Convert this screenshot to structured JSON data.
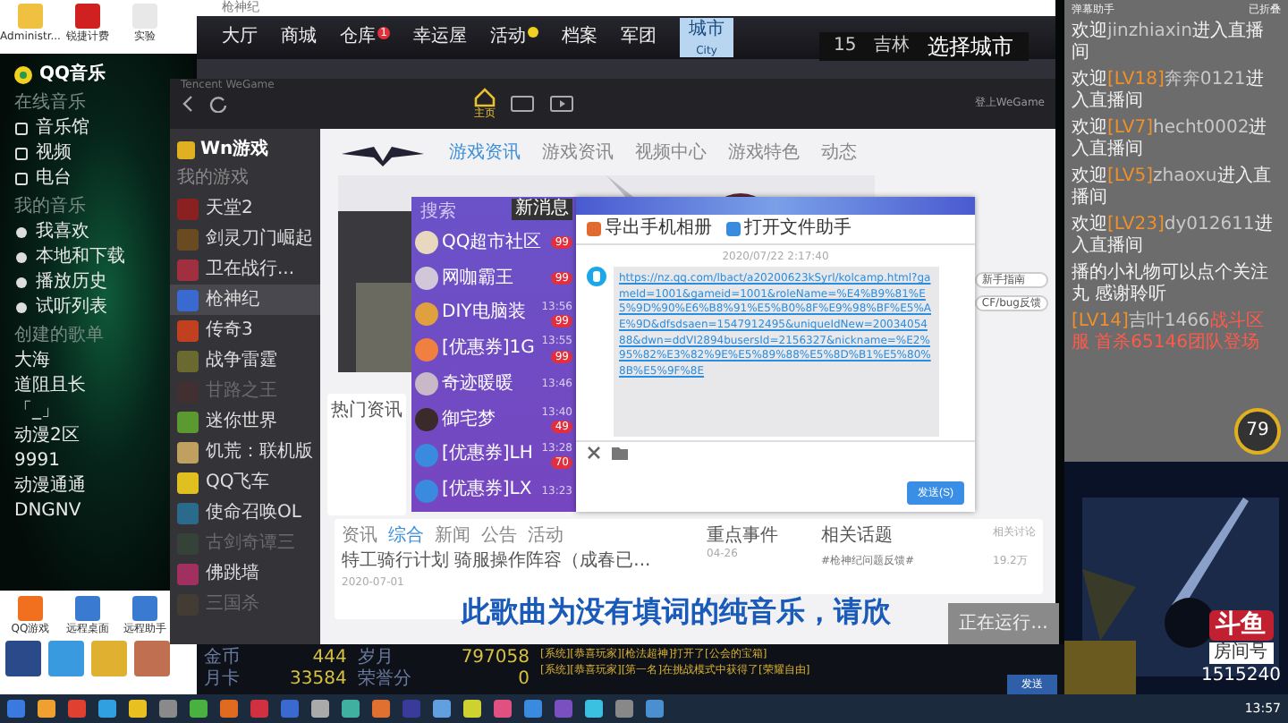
{
  "desktop_top_icons": [
    {
      "label": "Administr..."
    },
    {
      "label": "锐捷计费"
    },
    {
      "label": "实验"
    }
  ],
  "music_player": {
    "title": "QQ音乐",
    "group_label": "在线音乐",
    "items": [
      {
        "label": "音乐馆"
      },
      {
        "label": "视频"
      },
      {
        "label": "电台"
      }
    ],
    "my_label": "我的音乐",
    "my_items": [
      {
        "label": "我喜欢"
      },
      {
        "label": "本地和下载"
      },
      {
        "label": "播放历史"
      },
      {
        "label": "试听列表"
      }
    ],
    "playlists_label": "创建的歌单",
    "playlists": [
      {
        "label": "大海"
      },
      {
        "label": "道阻且长"
      },
      {
        "label": "「_」"
      },
      {
        "label": "动漫2区"
      },
      {
        "label": "9991"
      },
      {
        "label": "动漫通通"
      },
      {
        "label": "DNGNV"
      }
    ]
  },
  "desktop_bottom_icons": [
    {
      "label": "QQ游戏"
    },
    {
      "label": "远程桌面"
    },
    {
      "label": "远程助手"
    }
  ],
  "game_window": {
    "title": "枪神纪",
    "nav": [
      {
        "label": "大厅",
        "selected": false,
        "dot": false
      },
      {
        "label": "商城",
        "selected": false,
        "dot": false
      },
      {
        "label": "仓库",
        "selected": false,
        "dot": false,
        "badge": "1"
      },
      {
        "label": "幸运屋",
        "selected": false,
        "dot": false
      },
      {
        "label": "活动",
        "selected": false,
        "dot": true
      },
      {
        "label": "档案",
        "selected": false,
        "dot": false
      },
      {
        "label": "军团",
        "selected": false,
        "dot": false
      },
      {
        "label": "城市",
        "sublabel": "City",
        "selected": true,
        "dot": false
      }
    ],
    "channel": "15",
    "region": "吉林",
    "select_city": "选择城市"
  },
  "wegame": {
    "title": "Tencent WeGame",
    "home_label": "主页",
    "login": "登上WeGame",
    "account": "Wn游戏",
    "group": "我的游戏",
    "games": [
      {
        "name": "天堂2",
        "dimmed": false,
        "selected": false
      },
      {
        "name": "剑灵刀门崛起",
        "dimmed": false,
        "selected": false
      },
      {
        "name": "卫在战行...",
        "dimmed": false,
        "selected": false
      },
      {
        "name": "枪神纪",
        "dimmed": false,
        "selected": true
      },
      {
        "name": "传奇3",
        "dimmed": false,
        "selected": false
      },
      {
        "name": "战争雷霆",
        "dimmed": false,
        "selected": false
      },
      {
        "name": "甘路之王",
        "dimmed": true,
        "selected": false
      },
      {
        "name": "迷你世界",
        "dimmed": false,
        "selected": false
      },
      {
        "name": "饥荒：联机版",
        "dimmed": false,
        "selected": false
      },
      {
        "name": "QQ飞车",
        "dimmed": false,
        "selected": false
      },
      {
        "name": "使命召唤OL",
        "dimmed": false,
        "selected": false
      },
      {
        "name": "古剑奇谭三",
        "dimmed": true,
        "selected": false
      },
      {
        "name": "佛跳墙",
        "dimmed": false,
        "selected": false
      },
      {
        "name": "三国杀",
        "dimmed": true,
        "selected": false
      }
    ],
    "tabs": [
      {
        "label": "游戏资讯",
        "selected": true
      },
      {
        "label": "游戏资讯",
        "selected": false
      },
      {
        "label": "视频中心",
        "selected": false
      },
      {
        "label": "游戏特色",
        "selected": false
      },
      {
        "label": "动态",
        "selected": false
      }
    ],
    "hot_news": "热门资讯",
    "news_tabs": [
      {
        "label": "资讯",
        "selected": false
      },
      {
        "label": "综合",
        "selected": true
      },
      {
        "label": "新闻",
        "selected": false
      },
      {
        "label": "公告",
        "selected": false
      },
      {
        "label": "活动",
        "selected": false
      }
    ],
    "news_item": "特工骑行计划 骑服操作阵容（成春已...",
    "news_date": "2020-07-01",
    "events_title": "重点事件",
    "events_date": "04-26",
    "topics_title": "相关话题",
    "topics_more": "相关讨论",
    "topic": "#枪神纪问题反馈#",
    "topic_count": "19.2万",
    "side_links": [
      {
        "label": "新手指南"
      },
      {
        "label": "CF/bug反馈"
      }
    ]
  },
  "qq_list": {
    "search": "搜索",
    "tooltip": "新消息",
    "chats": [
      {
        "name": "QQ超市社区",
        "badge": "99"
      },
      {
        "name": "网咖霸王",
        "badge": "99"
      },
      {
        "name": "DIY电脑装",
        "time": "13:56",
        "badge": "99"
      },
      {
        "name": "[优惠券]1G",
        "time": "13:55",
        "badge": "99"
      },
      {
        "name": "奇迹暖暖",
        "time": "13:46"
      },
      {
        "name": "御宅梦",
        "time": "13:40",
        "badge": "49"
      },
      {
        "name": "[优惠券]LH",
        "time": "13:28",
        "badge": "70"
      },
      {
        "name": "[优惠券]LX",
        "time": "13:23"
      }
    ]
  },
  "chat_window": {
    "actions": [
      {
        "label": "导出手机相册"
      },
      {
        "label": "打开文件助手"
      }
    ],
    "timestamp": "2020/07/22 2:17:40",
    "message": "https://nz.qq.com/lbact/a20200623kSyrl/kolcamp.html?gameId=1001&gameid=1001&roleName=%E4%B9%81%E5%9D%90%E6%B8%91%E5%B0%8F%E9%98%BF%E5%AE%9D&dfsdsaen=1547912495&uniqueIdNew=2003405488&dwn=ddVI2894busersId=2156327&nickname=%E2%95%82%E3%82%9E%E5%89%88%E5%8D%B1%E5%80%8B%E5%9F%8E",
    "send": "发送(S)"
  },
  "subtitle": "此歌曲为没有填词的纯音乐，请欣",
  "running": "正在运行...",
  "game_stats": [
    {
      "label": "金币",
      "value": "444"
    },
    {
      "label": "岁月",
      "value": "797058"
    },
    {
      "label": "月卡",
      "value": "33584"
    },
    {
      "label": "荣誉分",
      "value": "0"
    }
  ],
  "game_log": [
    {
      "text": "[系统][恭喜玩家][枪法超神]打开了[公会的宝箱]"
    },
    {
      "text": "[系统][恭喜玩家][第一名]在挑战模式中获得了[荣耀自由]"
    }
  ],
  "game_send": "发送",
  "stream_chat": {
    "title": "弹幕助手",
    "status": "已折叠",
    "messages": [
      {
        "kind": "welcome",
        "pre": "欢迎",
        "user": "jinzhiaxin",
        "post": "进入直播间"
      },
      {
        "kind": "welcome",
        "pre": "欢迎",
        "level": "[LV18]",
        "user": "奔奔0121",
        "post": "进入直播间"
      },
      {
        "kind": "welcome",
        "pre": "欢迎",
        "level": "[LV7]",
        "user": "hecht0002",
        "post": "进入直播间"
      },
      {
        "kind": "welcome",
        "pre": "欢迎",
        "level": "[LV5]",
        "user": "zhaoxu",
        "post": "进入直播间"
      },
      {
        "kind": "welcome",
        "pre": "欢迎",
        "level": "[LV23]",
        "user": "dy012611",
        "post": "进入直播间"
      },
      {
        "kind": "system",
        "post": "播的小礼物可以点个关注丸 感谢聆听"
      },
      {
        "kind": "gift",
        "level": "[LV14]",
        "user": "吉叶1466",
        "post": "战斗区服 首杀65146团队登场"
      }
    ]
  },
  "speed_widget": {
    "value": "79"
  },
  "stream": {
    "logo": "斗鱼",
    "room_label": "房间号",
    "room": "1515240"
  },
  "clock": "13:57"
}
